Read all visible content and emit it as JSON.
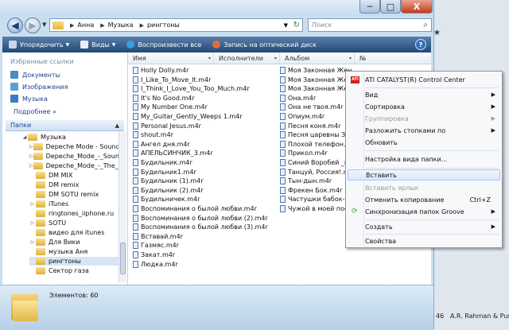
{
  "window": {
    "addr": {
      "crumbs": [
        "Анна",
        "Музыка",
        "рингтоны"
      ]
    },
    "search_placeholder": "Поиск",
    "buttons": {
      "min": "─",
      "max": "□",
      "close": "X"
    }
  },
  "toolbar": {
    "organize": "Упорядочить",
    "views": "Виды",
    "play_all": "Воспроизвести все",
    "burn": "Запись на оптический диск"
  },
  "left": {
    "fav_title": "Избранные ссылки",
    "favorites": [
      "Документы",
      "Изображения",
      "Музыка"
    ],
    "more": "Подробнее",
    "folders_title": "Папки",
    "tree": [
      "Музыка",
      "Depeche Mode - Sounds o",
      "Depeche_Mode_-_Sounds",
      "Depeche_Mode_-_The_Fif",
      "DM MIX",
      "DM remix",
      "DM SOTU remix",
      "iTunes",
      "ringtones_iiphone.ru",
      "SOTU",
      "видео для itunes",
      "Для Вики",
      "музыка Аня",
      "рингтоны",
      "Сектор газа"
    ]
  },
  "columns": {
    "name": "Имя",
    "artists": "Исполнители",
    "album": "Альбом",
    "num": "№"
  },
  "files_col1": [
    "Holly Dolly.m4r",
    "I_Like_To_Move_It.m4r",
    "I_Think_I_Love_You_Too_Much.m4r",
    "It's No Good.m4r",
    "My Number One.m4r",
    "My_Guitar_Gently_Weeps 1.m4r",
    "Personal Jesus.m4r",
    "shout.m4r",
    "Ангел дня.m4r",
    "АПЕЛЬСИНЧИК_3.m4r",
    "Будильник.m4r",
    "Будильник1.m4r",
    "Будильник (1).m4r",
    "Будильник (2).m4r",
    "Будильничек.m4r",
    "Воспоминания о былой любви.m4r",
    "Воспоминания о былой любви (2).m4r",
    "Воспоминания о былой любви (3).m4r",
    "Вставай.m4r",
    "Газмяс.m4r",
    "Закат.m4r",
    "Людка.m4r"
  ],
  "files_col2": [
    "Моя Законная Жена.m4r",
    "Моя Законная Жена 1",
    "Моя Законная Жена",
    "Она.m4r",
    "Она не твоя.m4r",
    "Опиум.m4r",
    "Песня коня.m4r",
    "Песня царевны Заб",
    "Плохой телефон.m4r",
    "Прикол.m4r",
    "Синий Воробей _пр",
    "Танцуй, Россия!.m4",
    "Тын-дын.m4r",
    "Фрекен Бок.m4r",
    "Частушки бабок-ех",
    "Чужой в моей пост"
  ],
  "status": {
    "count": "Элементов: 60"
  },
  "background": {
    "num": "46",
    "text": "A.R. Rahman & Pussy"
  },
  "context_menu": {
    "ati": "ATI CATALYST(R) Control Center",
    "view": "Вид",
    "sort": "Сортировка",
    "group": "Группировка",
    "stack": "Разложить стопками по",
    "refresh": "Обновить",
    "customize": "Настройка вида папки...",
    "paste": "Вставить",
    "paste_shortcut": "Вставить ярлык",
    "undo_copy": "Отменить копирование",
    "undo_shortcut": "Ctrl+Z",
    "sync": "Синхронизация папок Groove",
    "create": "Создать",
    "properties": "Свойства"
  },
  "colors": {
    "toolbar": "#1f4976",
    "highlight": "#d9e8fa",
    "folder": "#e3b848"
  },
  "icons": [
    "back-arrow-icon",
    "forward-arrow-icon",
    "folder-icon",
    "search-icon",
    "music-file-icon",
    "ati-icon",
    "sync-icon"
  ]
}
